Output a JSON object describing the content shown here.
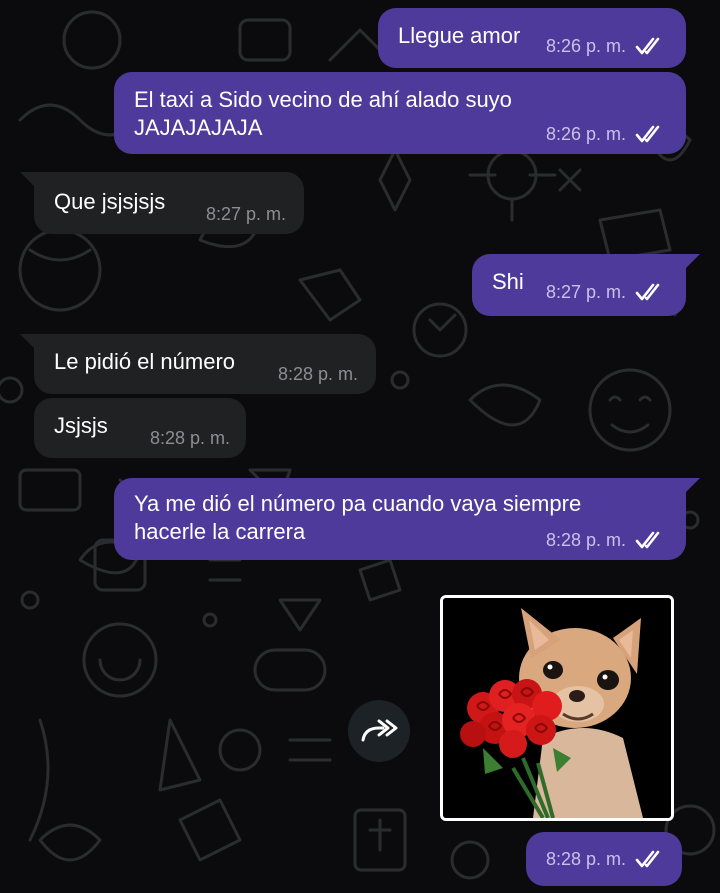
{
  "colors": {
    "background": "#0b0b0d",
    "outgoing_bubble": "#4e3a9a",
    "incoming_bubble": "#1f2123",
    "read_ticks": "#ffffff"
  },
  "messages": [
    {
      "direction": "out",
      "text": "Llegue amor",
      "time": "8:26 p. m.",
      "status": "read"
    },
    {
      "direction": "out",
      "text_lines": [
        "El taxi a Sido vecino de ahí alado suyo",
        "JAJAJAJAJA"
      ],
      "time": "8:26 p. m.",
      "status": "read"
    },
    {
      "direction": "in",
      "text": "Que jsjsjsjs",
      "time": "8:27 p. m."
    },
    {
      "direction": "out",
      "text": "Shi",
      "time": "8:27 p. m.",
      "status": "read"
    },
    {
      "direction": "in",
      "text": "Le pidió el número",
      "time": "8:28 p. m."
    },
    {
      "direction": "in",
      "text": "Jsjsjs",
      "time": "8:28 p. m."
    },
    {
      "direction": "out",
      "text_lines": [
        "Ya me dió el número pa cuando vaya siempre",
        "hacerle la carrera"
      ],
      "time": "8:28 p. m.",
      "status": "read"
    },
    {
      "direction": "out",
      "type": "sticker",
      "sticker": "chihuahua-with-roses-image",
      "time": "8:28 p. m.",
      "status": "read"
    }
  ],
  "icons": {
    "forward": "forward-share-icon",
    "read": "double-check-icon"
  }
}
